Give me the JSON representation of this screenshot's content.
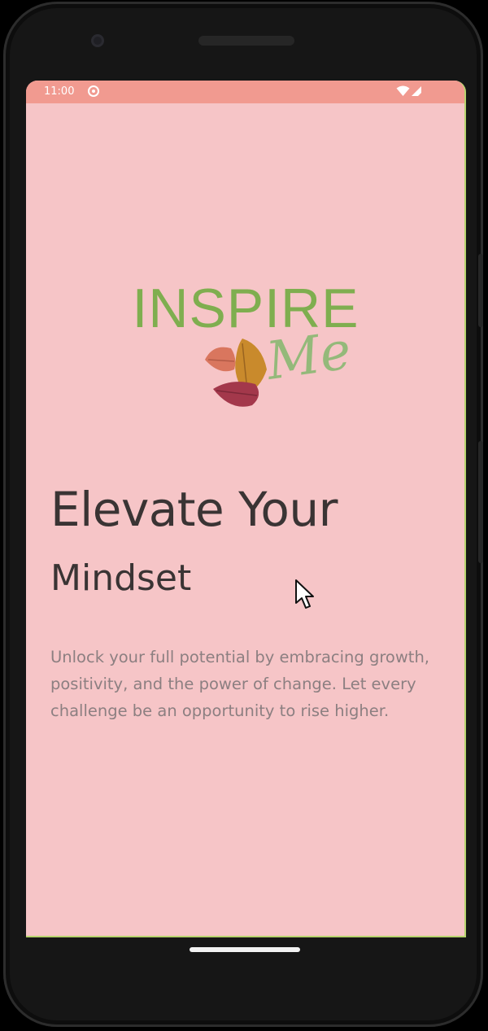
{
  "statusbar": {
    "time": "11:00",
    "app_icon": "notification-app-icon",
    "wifi_icon": "wifi-icon",
    "signal_icon": "cell-signal-icon"
  },
  "logo": {
    "word": "INSPIRE",
    "script": "Me",
    "leaves_icon": "autumn-leaves-icon"
  },
  "content": {
    "headline": "Elevate Your",
    "subheadline": "Mindset",
    "body": "Unlock your full potential by embracing growth, positivity, and the power of change. Let every challenge be an opportunity to rise higher."
  },
  "colors": {
    "screen_bg": "#f6c5c7",
    "statusbar_bg": "#f19a90",
    "logo_green": "#7fae4f",
    "headline": "#3a3434",
    "body_text": "#8c7f81"
  }
}
